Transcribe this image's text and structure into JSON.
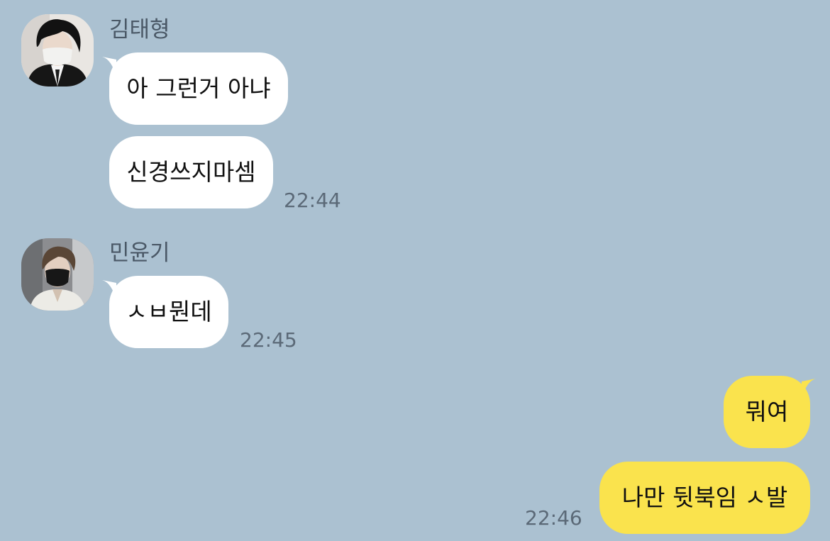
{
  "conversation": [
    {
      "sender": "김태형",
      "avatar_icon": "profile-photo-icon",
      "messages": [
        "아 그런거 아냐",
        "신경쓰지마셈"
      ],
      "time": "22:44"
    },
    {
      "sender": "민윤기",
      "avatar_icon": "profile-photo-icon",
      "messages": [
        "ㅅㅂ뭔데"
      ],
      "time": "22:45"
    },
    {
      "sender": "me",
      "messages": [
        "뭐여",
        "나만 뒷북임 ㅅ발"
      ],
      "time": "22:46"
    }
  ],
  "colors": {
    "background": "#abc1d1",
    "incoming_bubble": "#ffffff",
    "outgoing_bubble": "#fae34d",
    "name_text": "#4a5866",
    "time_text": "#5b6977"
  }
}
